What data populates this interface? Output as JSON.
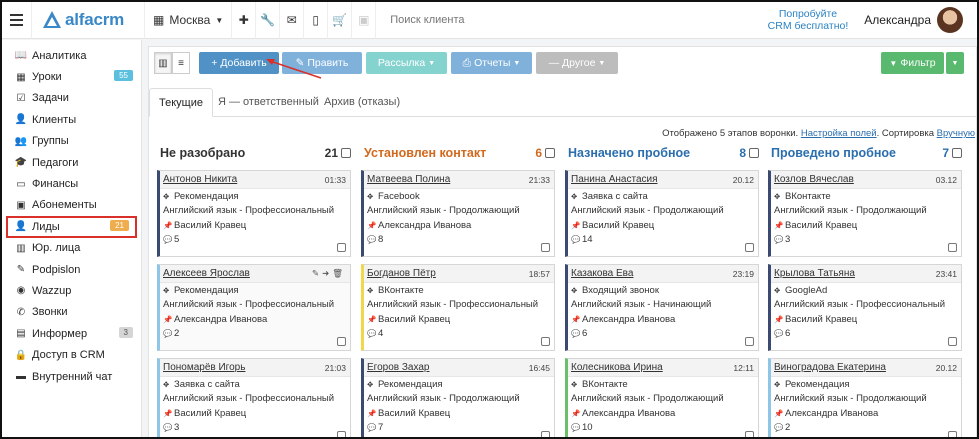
{
  "topbar": {
    "logo": "alfacrm",
    "city": "Москва",
    "search_placeholder": "Поиск клиента",
    "promo_line1": "Попробуйте",
    "promo_line2": "CRM бесплатно!",
    "user_name": "Александра"
  },
  "sidebar": [
    {
      "label": "Аналитика",
      "icon": "book-icon"
    },
    {
      "label": "Уроки",
      "icon": "calendar-icon",
      "badge": "55",
      "badge_color": "teal"
    },
    {
      "label": "Задачи",
      "icon": "tasks-icon"
    },
    {
      "label": "Клиенты",
      "icon": "user-icon"
    },
    {
      "label": "Группы",
      "icon": "group-icon"
    },
    {
      "label": "Педагоги",
      "icon": "graduation-icon"
    },
    {
      "label": "Финансы",
      "icon": "money-icon"
    },
    {
      "label": "Абонементы",
      "icon": "ticket-icon"
    },
    {
      "label": "Лиды",
      "icon": "user-plus-icon",
      "badge": "21",
      "badge_color": "orange",
      "active": true
    },
    {
      "label": "Юр. лица",
      "icon": "building-icon"
    },
    {
      "label": "Podpislon",
      "icon": "pen-icon"
    },
    {
      "label": "Wazzup",
      "icon": "whatsapp-icon"
    },
    {
      "label": "Звонки",
      "icon": "phone-icon"
    },
    {
      "label": "Информер",
      "icon": "inbox-icon",
      "badge": "3",
      "badge_color": "gray"
    },
    {
      "label": "Доступ в CRM",
      "icon": "lock-icon"
    },
    {
      "label": "Внутренний чат",
      "icon": "chat-icon"
    }
  ],
  "toolbar": {
    "add": "+ Добавить",
    "edit": "✎ Править",
    "mailing": "Рассылка",
    "reports": "Отчеты",
    "other": "— Другое",
    "filter": "Фильтр"
  },
  "tabs": [
    "Текущие",
    "Я — ответственный",
    "Архив (отказы)"
  ],
  "funnel_info": {
    "text1": "Отображено 5 этапов воронки.",
    "link1": "Настройка полей",
    "text2": ". Сортировка",
    "link2": "Вручную"
  },
  "columns": [
    {
      "title": "Не разобрано",
      "count": "21",
      "color": "#333333",
      "border": "#3b4a72",
      "cards": [
        {
          "name": "Антонов Никита",
          "time": "01:33",
          "source": "Рекомендация",
          "course": "Английский язык - Профессиональный",
          "manager": "Василий Кравец",
          "comments": "5"
        },
        {
          "name": "Алексеев Ярослав",
          "time": "",
          "source": "Рекомендация",
          "course": "Английский язык - Профессиональный",
          "manager": "Александра Иванова",
          "comments": "2",
          "border": "#8fc6e8"
        },
        {
          "name": "Пономарёв Игорь",
          "time": "21:03",
          "source": "Заявка с сайта",
          "course": "Английский язык - Профессиональный",
          "manager": "Василий Кравец",
          "comments": "3",
          "border": "#8fc6e8"
        }
      ]
    },
    {
      "title": "Установлен контакт",
      "count": "6",
      "color": "#d2691e",
      "border": "#3b4a72",
      "cards": [
        {
          "name": "Матвеева Полина",
          "time": "21:33",
          "source": "Facebook",
          "course": "Английский язык - Продолжающий",
          "manager": "Александра Иванова",
          "comments": "8"
        },
        {
          "name": "Богданов Пётр",
          "time": "18:57",
          "source": "ВКонтакте",
          "course": "Английский язык - Профессиональный",
          "manager": "Василий Кравец",
          "comments": "4",
          "border": "#f0d84a"
        },
        {
          "name": "Егоров Захар",
          "time": "16:45",
          "source": "Рекомендация",
          "course": "Английский язык - Продолжающий",
          "manager": "Василий Кравец",
          "comments": "7"
        }
      ]
    },
    {
      "title": "Назначено пробное",
      "count": "8",
      "color": "#2b6eae",
      "border": "#3b4a72",
      "cards": [
        {
          "name": "Панина Анастасия",
          "time": "20.12",
          "source": "Заявка с сайта",
          "course": "Английский язык - Продолжающий",
          "manager": "Василий Кравец",
          "comments": "14"
        },
        {
          "name": "Казакова Ева",
          "time": "23:19",
          "source": "Входящий звонок",
          "course": "Английский язык - Начинающий",
          "manager": "Александра Иванова",
          "comments": "6"
        },
        {
          "name": "Колесникова Ирина",
          "time": "12:11",
          "source": "ВКонтакте",
          "course": "Английский язык - Продолжающий",
          "manager": "Александра Иванова",
          "comments": "10",
          "border": "#6abf6a"
        }
      ]
    },
    {
      "title": "Проведено пробное",
      "count": "7",
      "color": "#2b6eae",
      "border": "#3b4a72",
      "cards": [
        {
          "name": "Козлов Вячеслав",
          "time": "03.12",
          "source": "ВКонтакте",
          "course": "Английский язык - Продолжающий",
          "manager": "Василий Кравец",
          "comments": "3"
        },
        {
          "name": "Крылова Татьяна",
          "time": "23:41",
          "source": "GoogleAd",
          "course": "Английский язык - Профессиональный",
          "manager": "Василий Кравец",
          "comments": "6"
        },
        {
          "name": "Виноградова Екатерина",
          "time": "20.12",
          "source": "Рекомендация",
          "course": "Английский язык - Продолжающий",
          "manager": "Александра Иванова",
          "comments": "2",
          "border": "#8fc6e8"
        }
      ]
    }
  ]
}
